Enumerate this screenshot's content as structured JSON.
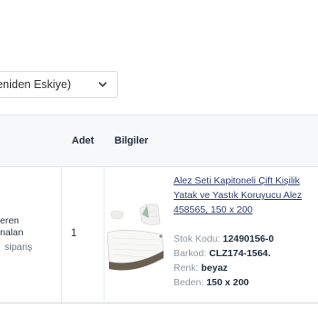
{
  "sort": {
    "value": "Yeniden Eskiye)"
  },
  "table": {
    "headers": {
      "qty": "Adet",
      "info": "Bilgiler"
    }
  },
  "order": {
    "store_line1": "eren",
    "store_line2": "nalan",
    "store_line3": "sipariş",
    "qty": "1",
    "product": {
      "title_lines": [
        "Alez Seti Kapitoneli Çift Kişilik",
        "Yatak ve Yastık Koruyucu Alez",
        "458565, 150 x 200"
      ],
      "specs": [
        {
          "label": "Stok Kodu:",
          "value": "12490156-0"
        },
        {
          "label": "Barkod:",
          "value": "CLZ174-1564."
        },
        {
          "label": "Renk:",
          "value": "beyaz"
        },
        {
          "label": "Beden:",
          "value": "150 x 200"
        }
      ]
    }
  },
  "colors": {
    "link": "#2c3e73",
    "muted": "#8d97a1",
    "header_bg": "#f6f8fa"
  }
}
